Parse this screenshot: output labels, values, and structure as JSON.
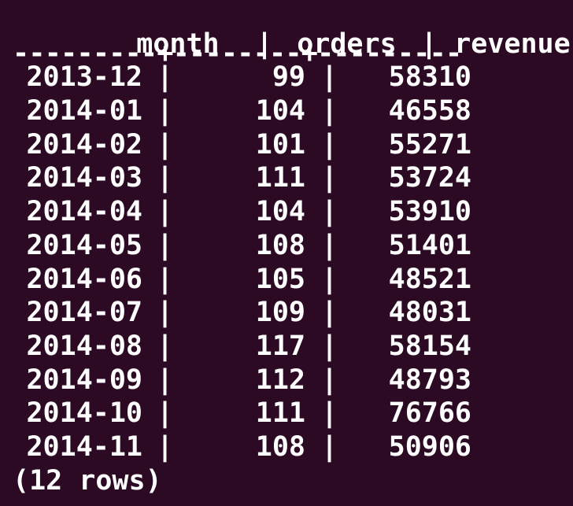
{
  "table": {
    "headers": [
      "month",
      "orders",
      "revenue"
    ],
    "divider": "---------+--------+---------",
    "column_separator": "|",
    "rows": [
      {
        "month": "2013-12",
        "orders": "99",
        "revenue": "58310"
      },
      {
        "month": "2014-01",
        "orders": "104",
        "revenue": "46558"
      },
      {
        "month": "2014-02",
        "orders": "101",
        "revenue": "55271"
      },
      {
        "month": "2014-03",
        "orders": "111",
        "revenue": "53724"
      },
      {
        "month": "2014-04",
        "orders": "104",
        "revenue": "53910"
      },
      {
        "month": "2014-05",
        "orders": "108",
        "revenue": "51401"
      },
      {
        "month": "2014-06",
        "orders": "105",
        "revenue": "48521"
      },
      {
        "month": "2014-07",
        "orders": "109",
        "revenue": "48031"
      },
      {
        "month": "2014-08",
        "orders": "117",
        "revenue": "58154"
      },
      {
        "month": "2014-09",
        "orders": "112",
        "revenue": "48793"
      },
      {
        "month": "2014-10",
        "orders": "111",
        "revenue": "76766"
      },
      {
        "month": "2014-11",
        "orders": "108",
        "revenue": "50906"
      }
    ],
    "footer": "(12 rows)"
  },
  "colors": {
    "background": "#2c0a24",
    "text": "#ffffff"
  }
}
